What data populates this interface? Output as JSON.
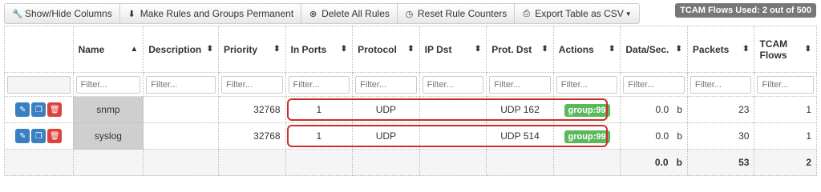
{
  "toolbar": {
    "show_hide": "Show/Hide Columns",
    "make_perm": "Make Rules and Groups Permanent",
    "delete_all": "Delete All Rules",
    "reset_counters": "Reset Rule Counters",
    "export_csv": "Export Table as CSV"
  },
  "tcam_badge": "TCAM Flows Used: 2 out of 500",
  "columns": {
    "name": "Name",
    "description": "Description",
    "priority": "Priority",
    "in_ports": "In Ports",
    "protocol": "Protocol",
    "ip_dst": "IP Dst",
    "prot_dst": "Prot. Dst",
    "actions": "Actions",
    "data_sec": "Data/Sec.",
    "packets": "Packets",
    "tcam_flows": "TCAM Flows"
  },
  "filter_placeholder": "Filter...",
  "rows": [
    {
      "name": "snmp",
      "description": "",
      "priority": "32768",
      "in_ports": "1",
      "protocol": "UDP",
      "ip_dst": "",
      "prot_dst": "UDP 162",
      "action": "group:99",
      "data_val": "0.0",
      "data_unit": "b",
      "packets": "23",
      "tcam": "1"
    },
    {
      "name": "syslog",
      "description": "",
      "priority": "32768",
      "in_ports": "1",
      "protocol": "UDP",
      "ip_dst": "",
      "prot_dst": "UDP 514",
      "action": "group:99",
      "data_val": "0.0",
      "data_unit": "b",
      "packets": "30",
      "tcam": "1"
    }
  ],
  "totals": {
    "data_val": "0.0",
    "data_unit": "b",
    "packets": "53",
    "tcam": "2"
  },
  "colors": {
    "highlight": "#c9302c",
    "action_badge": "#5cb85c",
    "edit_button": "#3a7fc1",
    "delete_button": "#d9433c"
  }
}
